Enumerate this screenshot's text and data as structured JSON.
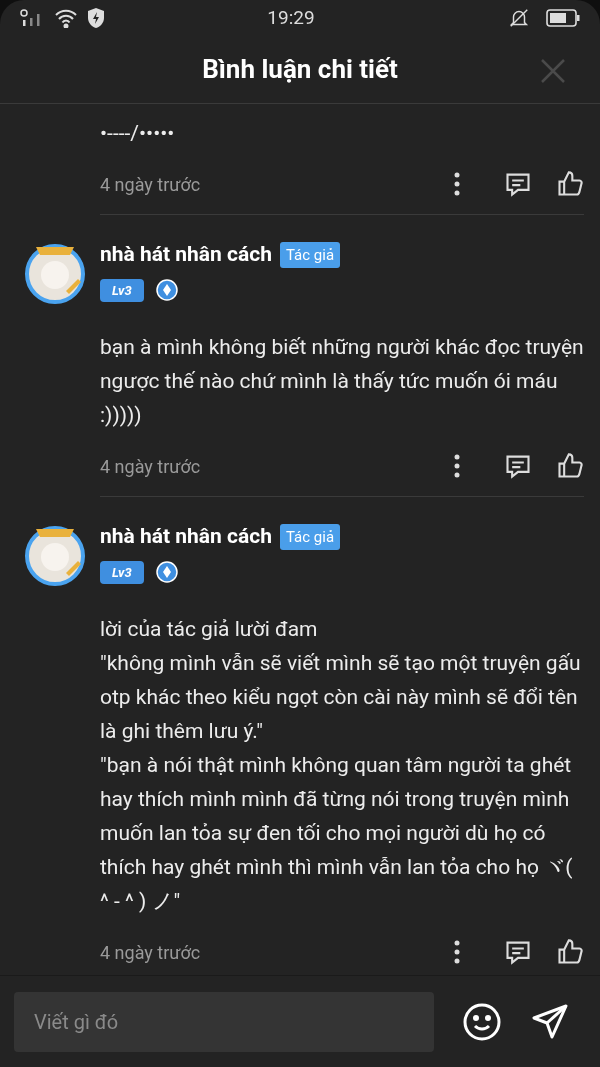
{
  "status_bar": {
    "time": "19:29"
  },
  "header": {
    "title": "Bình luận chi tiết"
  },
  "comments": [
    {
      "body": [
        "•----/•••••"
      ],
      "time": "4 ngày trước"
    },
    {
      "author": {
        "name": "nhà hát nhân cách",
        "badge": "Tác giả",
        "level": "Lv3"
      },
      "body": [
        "bạn à mình không biết những người khác đọc truyện ngược thế nào chứ mình là thấy tức muốn ói máu :)))))"
      ],
      "time": "4 ngày trước"
    },
    {
      "author": {
        "name": "nhà hát nhân cách",
        "badge": "Tác giả",
        "level": "Lv3"
      },
      "body": [
        "lời của tác giả lười đam",
        "\"không mình vẫn sẽ viết mình sẽ tạo một truyện gấu otp khác theo kiểu ngọt còn cài này mình sẽ đổi tên là ghi thêm lưu ý.\"",
        "\"bạn à nói thật mình không quan tâm người ta ghét hay thích mình mình đã từng nói trong truyện mình muốn lan tỏa sự đen tối cho mọi người dù họ có thích hay ghét mình thì mình vẫn lan tỏa cho họ ヾ( ^ - ^ ) ノ\""
      ],
      "time": "4 ngày trước"
    }
  ],
  "composer": {
    "placeholder": "Viết gì đó"
  }
}
